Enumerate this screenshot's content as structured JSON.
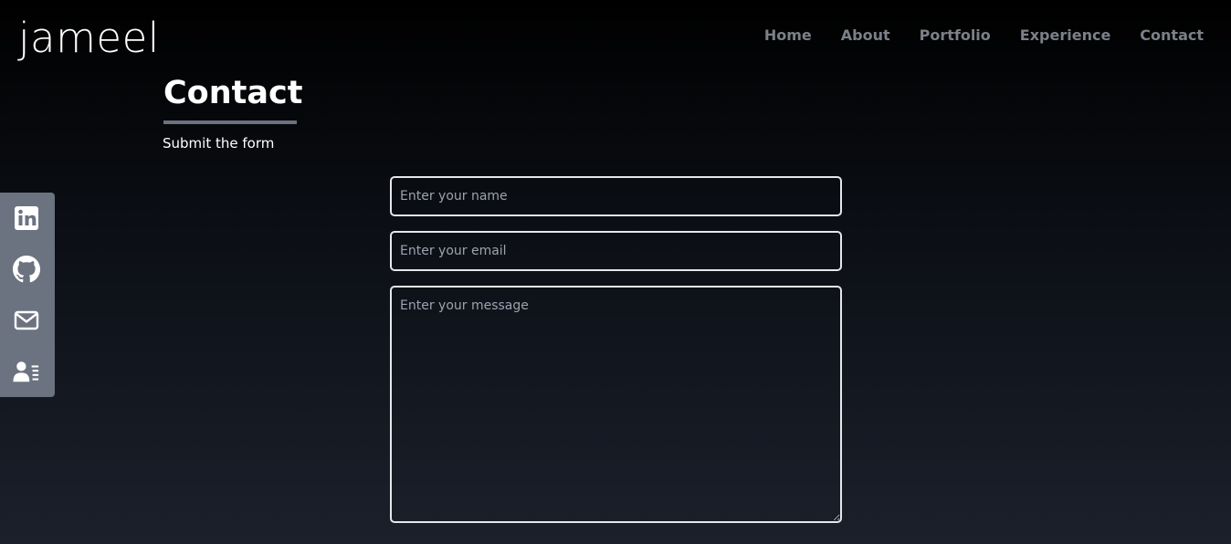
{
  "header": {
    "logo": "jameel",
    "nav": [
      "Home",
      "About",
      "Portfolio",
      "Experience",
      "Contact"
    ]
  },
  "section": {
    "title": "Contact",
    "subtitle": "Submit the form"
  },
  "social": {
    "icons": [
      "linkedin-icon",
      "github-icon",
      "mail-icon",
      "resume-icon"
    ]
  },
  "form": {
    "name_placeholder": "Enter your name",
    "email_placeholder": "Enter your email",
    "message_placeholder": "Enter your message",
    "name_value": "",
    "email_value": "",
    "message_value": ""
  },
  "colors": {
    "accent": "#6b7280",
    "nav_text": "#7b8089",
    "field_border": "#e5e7eb",
    "placeholder": "#9ca3af"
  }
}
